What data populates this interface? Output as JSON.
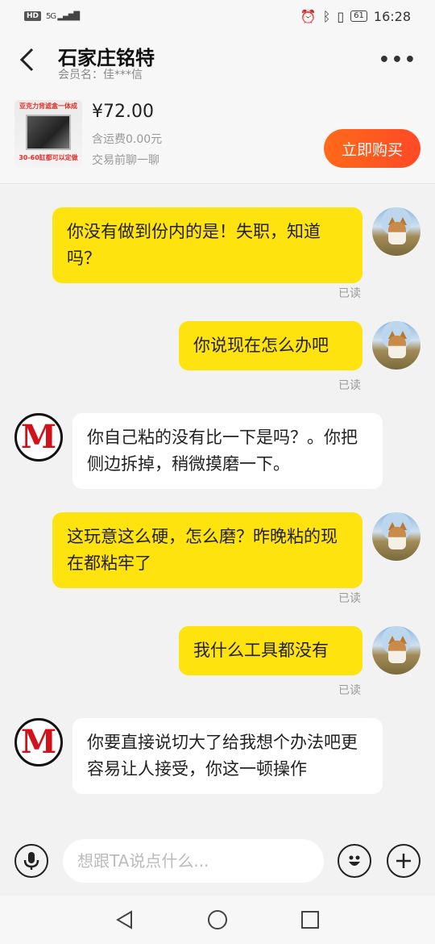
{
  "status_bar": {
    "hd": "HD",
    "network": "5G",
    "battery": "61",
    "time": "16:28"
  },
  "header": {
    "title": "石家庄铭特",
    "member": "会员名：佳***信"
  },
  "product": {
    "image_top_text": "亚克力背滤盒一体成",
    "image_bottom_text": "30-60缸都可以定做",
    "price": "¥72.00",
    "shipping": "含运费0.00元",
    "chat_hint": "交易前聊一聊",
    "buy_label": "立即购买"
  },
  "messages": [
    {
      "from": "me",
      "text": "你没有做到份内的是！失职，知道吗？",
      "status": "已读"
    },
    {
      "from": "me",
      "text": "你说现在怎么办吧",
      "status": "已读"
    },
    {
      "from": "them",
      "text": "你自己粘的没有比一下是吗？。你把侧边拆掉，稍微摸磨一下。"
    },
    {
      "from": "me",
      "text": "这玩意这么硬，怎么磨？昨晚粘的现在都粘牢了",
      "status": "已读"
    },
    {
      "from": "me",
      "text": "我什么工具都没有",
      "status": "已读"
    },
    {
      "from": "them",
      "text": "你要直接说切大了给我想个办法吧更容易让人接受，你这一顿操作"
    }
  ],
  "shop_avatar_letter": "M",
  "input": {
    "placeholder": "想跟TA说点什么..."
  },
  "colors": {
    "accent": "#ff5722",
    "my_bubble": "#ffe30f"
  }
}
